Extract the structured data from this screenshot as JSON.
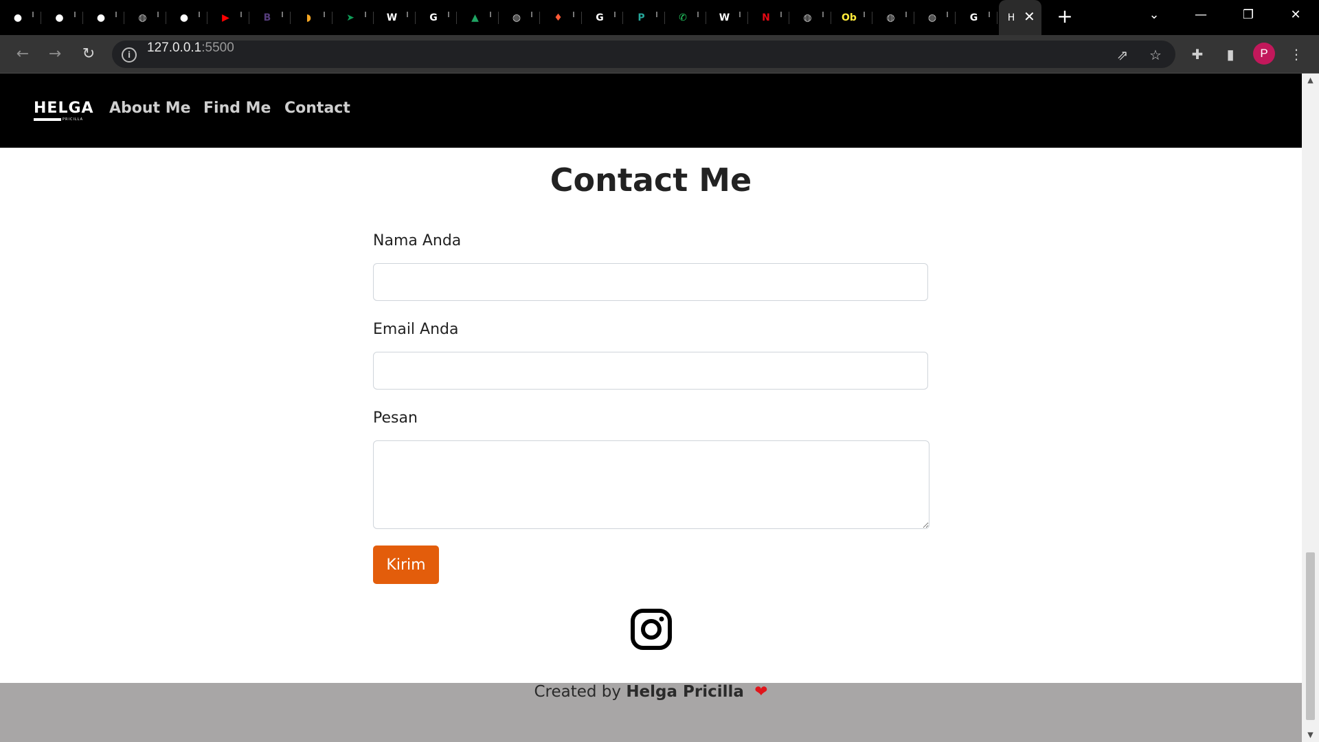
{
  "browser": {
    "tabs": [
      {
        "icon": "github-icon",
        "color": "#ffffff"
      },
      {
        "icon": "github-icon",
        "color": "#ffffff"
      },
      {
        "icon": "github-icon",
        "color": "#ffffff"
      },
      {
        "icon": "globe-icon",
        "color": "#cfcfcf"
      },
      {
        "icon": "github-icon",
        "color": "#ffffff"
      },
      {
        "icon": "youtube-icon",
        "color": "#ff0000"
      },
      {
        "icon": "bootstrap-icon",
        "color": "#563d7c"
      },
      {
        "icon": "flame-icon",
        "color": "#f5a623"
      },
      {
        "icon": "paper-plane-icon",
        "color": "#0f9d58"
      },
      {
        "icon": "wikipedia-icon",
        "color": "#ffffff"
      },
      {
        "icon": "google-icon",
        "color": "#ffffff"
      },
      {
        "icon": "google-drive-icon",
        "color": "#1fa463"
      },
      {
        "icon": "globe-icon",
        "color": "#cfcfcf"
      },
      {
        "icon": "fire-icon",
        "color": "#ff5a36"
      },
      {
        "icon": "google-icon",
        "color": "#ffffff"
      },
      {
        "icon": "p-app-icon",
        "color": "#26a69a"
      },
      {
        "icon": "whatsapp-icon",
        "color": "#25d366"
      },
      {
        "icon": "wikipedia-icon",
        "color": "#ffffff"
      },
      {
        "icon": "netflix-icon",
        "color": "#e50914"
      },
      {
        "icon": "globe-icon",
        "color": "#cfcfcf"
      },
      {
        "icon": "ob-icon",
        "color": "#ffeb3b"
      },
      {
        "icon": "globe-icon",
        "color": "#cfcfcf"
      },
      {
        "icon": "globe-icon",
        "color": "#cfcfcf"
      },
      {
        "icon": "google-icon",
        "color": "#ffffff"
      }
    ],
    "active_tab_label": "H",
    "url_host": "127.0.0.1",
    "url_port": ":5500",
    "profile_initial": "P"
  },
  "site": {
    "brand": "HELGA",
    "brand_sub": "PRICILLA",
    "nav": [
      {
        "label": "About Me"
      },
      {
        "label": "Find Me"
      },
      {
        "label": "Contact"
      }
    ],
    "title": "Contact Me",
    "form": {
      "name_label": "Nama Anda",
      "email_label": "Email Anda",
      "message_label": "Pesan",
      "submit_label": "Kirim"
    },
    "social_icon": "instagram-icon",
    "footer": {
      "prefix": "Created by",
      "author": "Helga Pricilla",
      "heart": "❤"
    },
    "colors": {
      "accent": "#e35d0b",
      "nav_bg": "#000000",
      "footer_bg": "#a8a6a6"
    }
  }
}
